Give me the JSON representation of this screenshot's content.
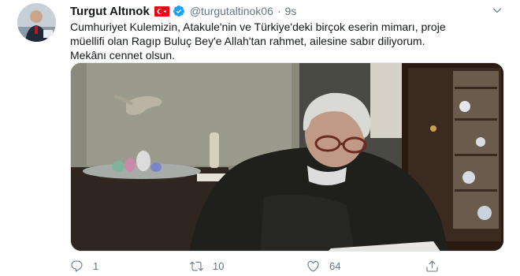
{
  "tweet": {
    "author_name": "Turgut Altınok",
    "handle": "@turgutaltinok06",
    "separator": "·",
    "time": "9s",
    "text_lines": [
      "Cumhuriyet Kulemizin, Atakule'nin ve Türkiye'deki birçok eserin mimarı, proje",
      "müellifi olan Ragıp Buluç Bey'e Allah'tan rahmet, ailesine sabır diliyorum.",
      "Mekânı cennet olsun."
    ]
  },
  "icons": {
    "flag": "turkey-flag-icon",
    "verified": "verified-badge-icon",
    "caret": "chevron-down-icon",
    "reply": "reply-icon",
    "retweet": "retweet-icon",
    "like": "heart-icon",
    "share": "share-icon"
  },
  "actions": {
    "reply_count": "1",
    "retweet_count": "10",
    "like_count": "64"
  },
  "colors": {
    "verified": "#1da1f2",
    "flag_red": "#e30a17",
    "muted": "#657786"
  }
}
